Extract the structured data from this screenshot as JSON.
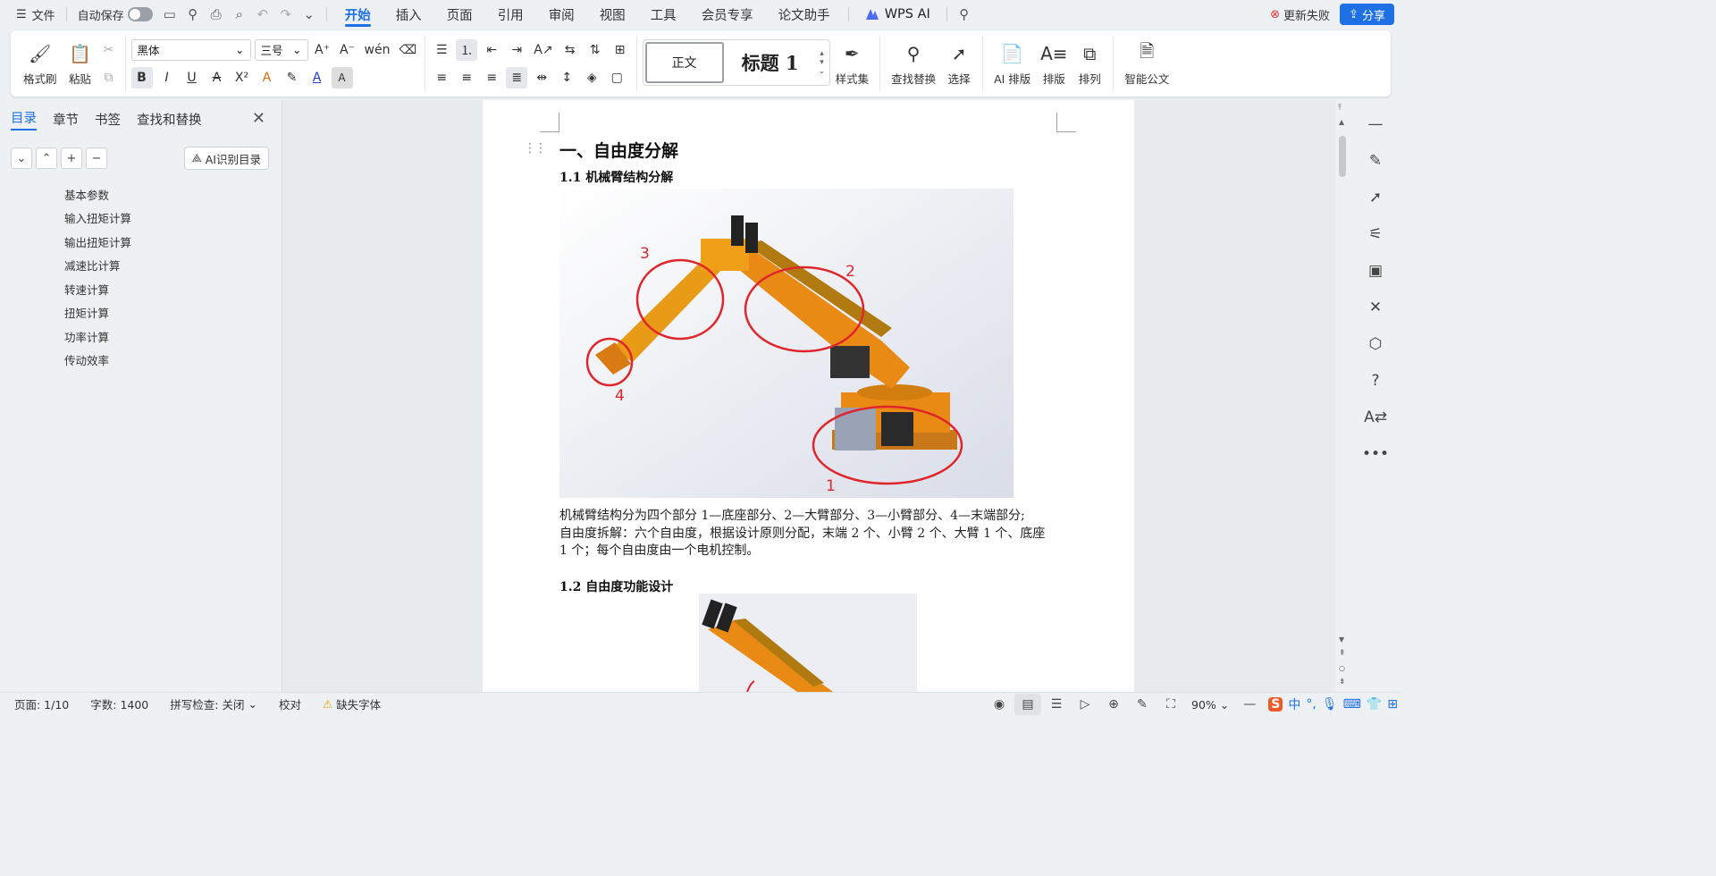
{
  "topbar": {
    "file_label": "文件",
    "autosave_label": "自动保存",
    "menu_tabs": [
      "开始",
      "插入",
      "页面",
      "引用",
      "审阅",
      "视图",
      "工具",
      "会员专享",
      "论文助手"
    ],
    "wps_ai_label": "WPS AI",
    "update_fail_label": "更新失败",
    "share_label": "分享"
  },
  "ribbon": {
    "format_painter": "格式刷",
    "paste": "粘贴",
    "font_name": "黑体",
    "font_size": "三号",
    "style_normal": "正文",
    "style_heading1": "标题 1",
    "style_set": "样式集",
    "find_replace": "查找替换",
    "select": "选择",
    "ai_layout": "AI 排版",
    "layout": "排版",
    "arrange": "排列",
    "smart_doc": "智能公文"
  },
  "left_panel": {
    "tabs": [
      "目录",
      "章节",
      "书签",
      "查找和替换"
    ],
    "ai_toc_label": "AI识别目录",
    "toc_items": [
      "基本参数",
      "输入扭矩计算",
      "输出扭矩计算",
      "减速比计算",
      "转速计算",
      "扭矩计算",
      "功率计算",
      "传动效率"
    ]
  },
  "document": {
    "heading1": "一、自由度分解",
    "heading_1_1": "1.1 机械臂结构分解",
    "figure_labels": [
      "1",
      "2",
      "3",
      "4"
    ],
    "paragraph_lines": [
      "机械臂结构分为四个部分 1—底座部分、2—大臂部分、3—小臂部分、4—末端部分;",
      "自由度拆解：六个自由度，根据设计原则分配，末端 2 个、小臂 2 个、大臂 1 个、底座",
      "1 个；每个自由度由一个电机控制。"
    ],
    "heading_1_2": "1.2 自由度功能设计"
  },
  "statusbar": {
    "page": "页面: 1/10",
    "word_count": "字数: 1400",
    "spell_check": "拼写检查: 关闭",
    "proofread": "校对",
    "missing_font": "缺失字体",
    "zoom": "90%"
  },
  "colors": {
    "accent": "#1f6fe5",
    "annotation_red": "#e0252b",
    "robot_orange": "#e88a14"
  }
}
